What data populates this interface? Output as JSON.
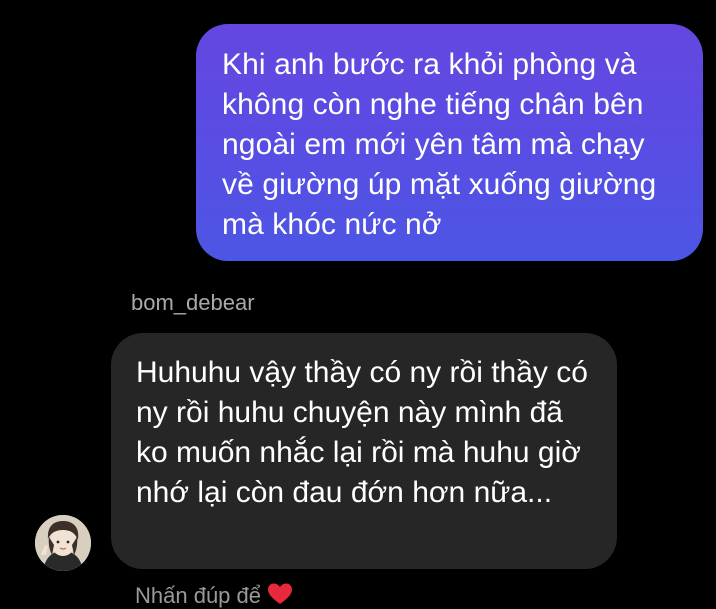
{
  "conversation": {
    "outgoing_message": {
      "text": "Khi anh bước ra khỏi phòng và không còn nghe tiếng chân bên ngoài em mới yên tâm mà chạy về giường úp mặt xuống giường mà khóc nức nở"
    },
    "incoming_message": {
      "sender": "bom_debear",
      "text": "Huhuhu vậy thầy có ny rồi thầy có ny rồi huhu chuyện này mình đã ko muốn nhắc lại rồi mà huhu giờ nhớ lại còn đau đớn hơn nữa..."
    },
    "double_tap_hint": "Nhấn đúp để",
    "reaction_icon": "heart-icon"
  },
  "colors": {
    "background": "#000000",
    "outgoing_bubble_top": "#6447e0",
    "outgoing_bubble_bottom": "#4c56e4",
    "incoming_bubble": "#262626",
    "heart": "#e8283d"
  }
}
